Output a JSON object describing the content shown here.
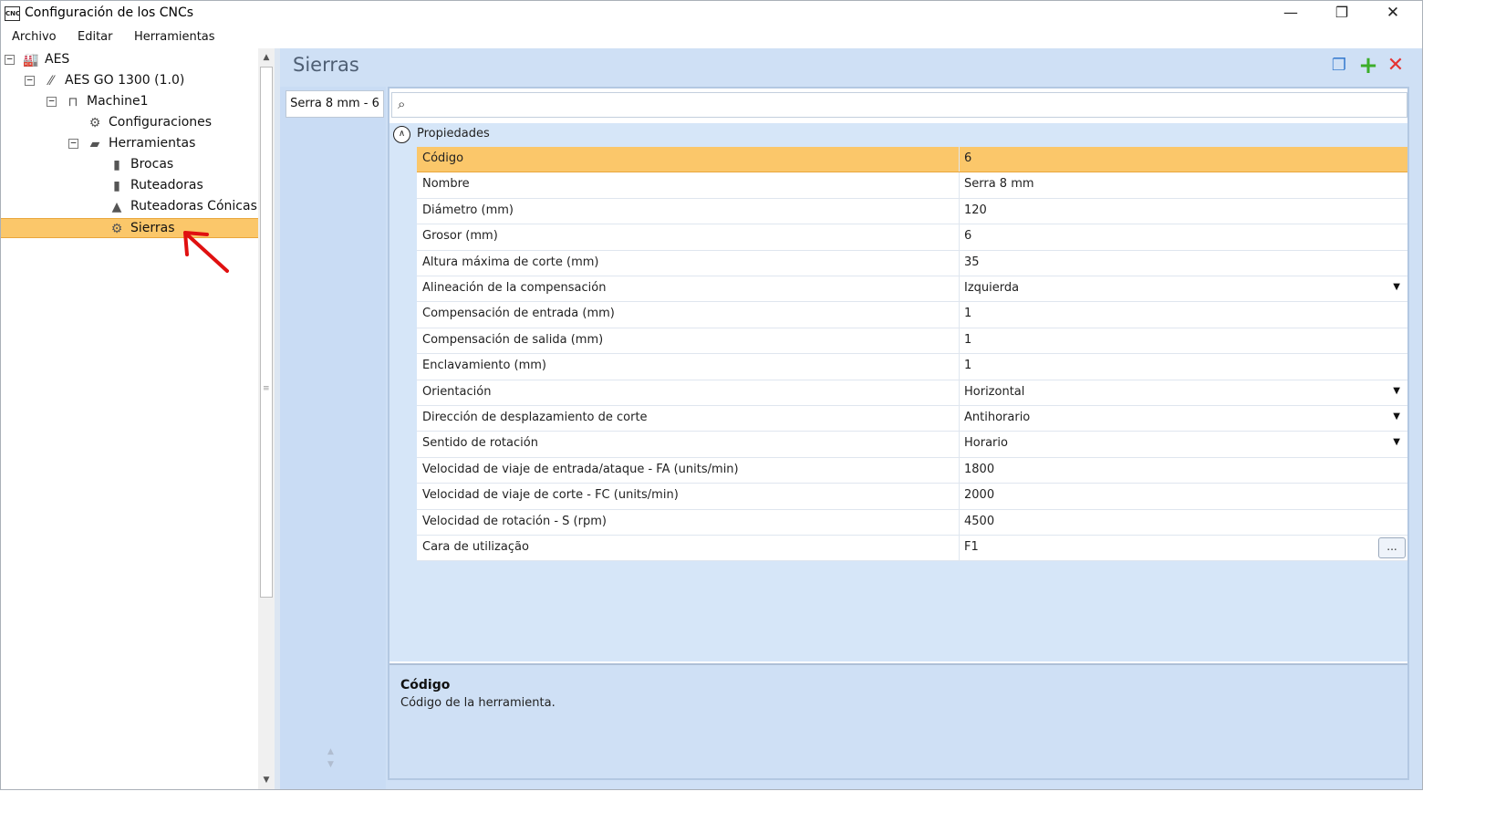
{
  "window": {
    "app_icon": "CNC",
    "title": "Configuración de los CNCs",
    "minimize": "—",
    "maximize": "❐",
    "close": "✕"
  },
  "menu": [
    "Archivo",
    "Editar",
    "Herramientas"
  ],
  "tree": [
    {
      "label": "AES",
      "level": 0,
      "expander": "−",
      "icon": "factory-icon",
      "glyph": "🏭"
    },
    {
      "label": "AES GO 1300 (1.0)",
      "level": 1,
      "expander": "−",
      "icon": "brand-logo-icon",
      "glyph": "⁄⁄"
    },
    {
      "label": "Machine1",
      "level": 2,
      "expander": "−",
      "icon": "machine-icon",
      "glyph": "⊓"
    },
    {
      "label": "Configuraciones",
      "level": 3,
      "expander": "",
      "icon": "gear-icon",
      "glyph": "⚙"
    },
    {
      "label": "Herramientas",
      "level": 3,
      "expander": "−",
      "icon": "toolbox-icon",
      "glyph": "▰"
    },
    {
      "label": "Brocas",
      "level": 4,
      "expander": "",
      "icon": "drill-bit-icon",
      "glyph": "▮"
    },
    {
      "label": "Ruteadoras",
      "level": 4,
      "expander": "",
      "icon": "router-bit-icon",
      "glyph": "▮"
    },
    {
      "label": "Ruteadoras Cónicas",
      "level": 4,
      "expander": "",
      "icon": "conical-bit-icon",
      "glyph": "▲"
    },
    {
      "label": "Sierras",
      "level": 4,
      "expander": "",
      "icon": "saw-blade-icon",
      "glyph": "⚙",
      "selected": true
    }
  ],
  "panel": {
    "title": "Sierras",
    "tab_label": "Serra 8 mm - 6",
    "search_placeholder": "",
    "category": "Propiedades"
  },
  "properties": [
    {
      "name": "Código",
      "value": "6",
      "selected": true
    },
    {
      "name": "Nombre",
      "value": "Serra 8 mm"
    },
    {
      "name": "Diámetro (mm)",
      "value": "120"
    },
    {
      "name": "Grosor (mm)",
      "value": "6"
    },
    {
      "name": "Altura máxima de corte (mm)",
      "value": "35"
    },
    {
      "name": "Alineación de la compensación",
      "value": "Izquierda",
      "dropdown": true
    },
    {
      "name": "Compensación de entrada (mm)",
      "value": "1"
    },
    {
      "name": "Compensación de salida (mm)",
      "value": "1"
    },
    {
      "name": "Enclavamiento (mm)",
      "value": "1"
    },
    {
      "name": "Orientación",
      "value": "Horizontal",
      "dropdown": true
    },
    {
      "name": "Dirección de desplazamiento de corte",
      "value": "Antihorario",
      "dropdown": true
    },
    {
      "name": "Sentido de rotación",
      "value": "Horario",
      "dropdown": true
    },
    {
      "name": "Velocidad de viaje de entrada/ataque - FA (units/min)",
      "value": "1800"
    },
    {
      "name": "Velocidad de viaje de corte - FC (units/min)",
      "value": "2000"
    },
    {
      "name": "Velocidad de rotación - S (rpm)",
      "value": "4500"
    },
    {
      "name": "Cara de utilização",
      "value": "F1",
      "ellipsis": "..."
    }
  ],
  "description": {
    "title": "Código",
    "text": "Código de la herramienta."
  },
  "colors": {
    "selection": "#fbc76a",
    "panel_bg": "#cfe0f5",
    "annotation_arrow": "#e01010"
  }
}
